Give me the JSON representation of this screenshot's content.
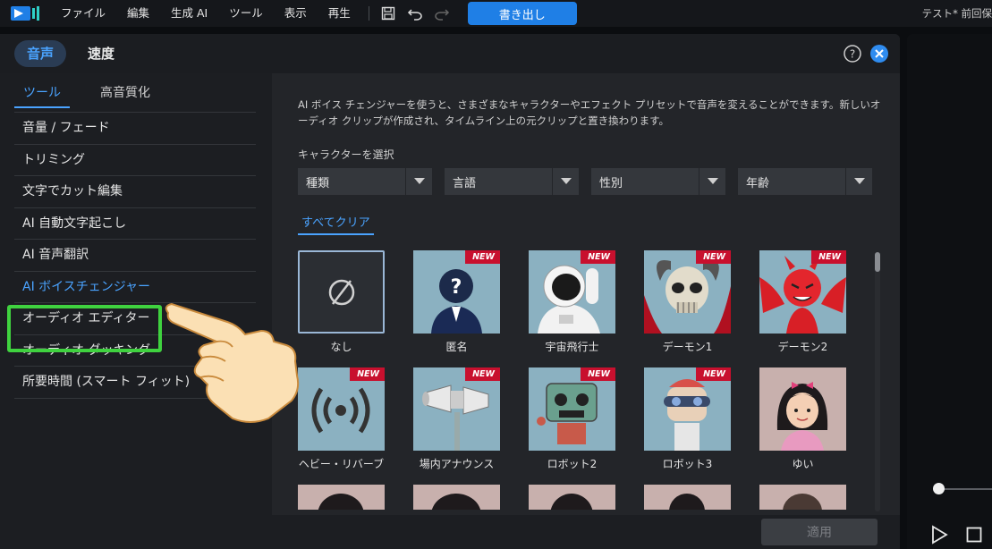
{
  "topbar": {
    "menu": [
      "ファイル",
      "編集",
      "生成 AI",
      "ツール",
      "表示",
      "再生"
    ],
    "export_label": "書き出し",
    "project_title": "テスト* 前回保"
  },
  "panel": {
    "tabs": [
      {
        "label": "音声",
        "active": true
      },
      {
        "label": "速度",
        "active": false
      }
    ],
    "sub_tabs": [
      {
        "label": "ツール",
        "active": true
      },
      {
        "label": "高音質化",
        "active": false
      }
    ],
    "tools": [
      {
        "label": "音量 / フェード"
      },
      {
        "label": "トリミング"
      },
      {
        "label": "文字でカット編集"
      },
      {
        "label": "AI 自動文字起こし"
      },
      {
        "label": "AI 音声翻訳"
      },
      {
        "label": "AI ボイスチェンジャー",
        "active": true
      },
      {
        "label": "オーディオ エディター"
      },
      {
        "label": "オーディオ ダッキング"
      },
      {
        "label": "所要時間 (スマート フィット)"
      }
    ],
    "description": "AI ボイス チェンジャーを使うと、さまざまなキャラクターやエフェクト プリセットで音声を変えることができます。新しいオーディオ クリップが作成され、タイムライン上の元クリップと置き換わります。",
    "select_label": "キャラクターを選択",
    "filters": [
      "種類",
      "言語",
      "性別",
      "年齢"
    ],
    "clear_all": "すべてクリア",
    "new_badge": "NEW",
    "characters": [
      {
        "label": "なし",
        "new": false
      },
      {
        "label": "匿名",
        "new": true
      },
      {
        "label": "宇宙飛行士",
        "new": true
      },
      {
        "label": "デーモン1",
        "new": true
      },
      {
        "label": "デーモン2",
        "new": true
      },
      {
        "label": "ヘビー・リバーブ",
        "new": true
      },
      {
        "label": "場内アナウンス",
        "new": true
      },
      {
        "label": "ロボット2",
        "new": true
      },
      {
        "label": "ロボット3",
        "new": true
      },
      {
        "label": "ゆい",
        "new": false
      }
    ],
    "apply_label": "適用"
  },
  "colors": {
    "accent": "#4aa3ff",
    "export_button": "#1f7fe6",
    "highlight_box": "#3fd23f",
    "new_badge": "#c8102e"
  }
}
